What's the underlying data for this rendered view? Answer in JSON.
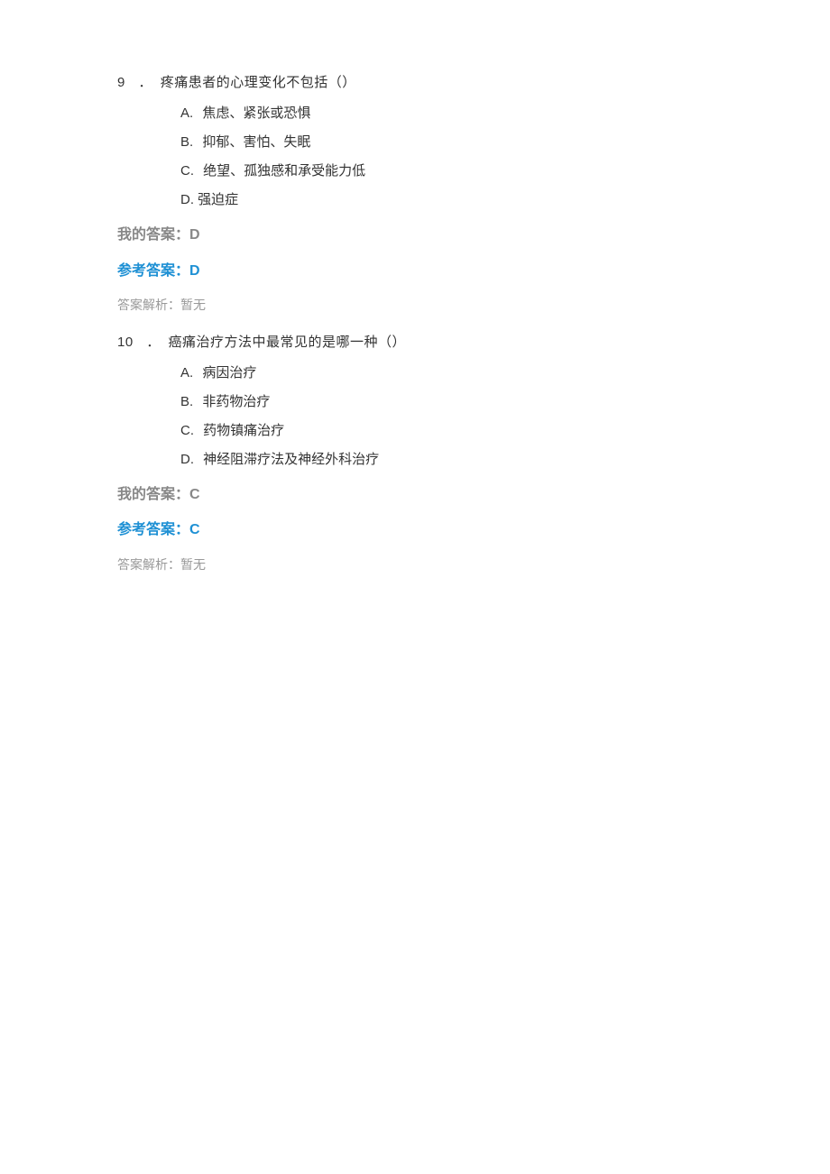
{
  "questions": [
    {
      "number": "9",
      "dot": "．",
      "stem": "疼痛患者的心理变化不包括（）",
      "options": [
        {
          "letter": "A.",
          "text": "焦虑、紧张或恐惧",
          "tight": false
        },
        {
          "letter": "B.",
          "text": "抑郁、害怕、失眠",
          "tight": false
        },
        {
          "letter": "C.",
          "text": "绝望、孤独感和承受能力低",
          "tight": false
        },
        {
          "letter": "D.",
          "text": "强迫症",
          "tight": true
        }
      ],
      "myAnswerLabel": "我的答案：",
      "myAnswerValue": "D",
      "refAnswerLabel": "参考答案：",
      "refAnswerValue": "D",
      "analysisLabel": "答案解析：",
      "analysisText": "暂无"
    },
    {
      "number": "10",
      "dot": "．",
      "stem": "癌痛治疗方法中最常见的是哪一种（）",
      "options": [
        {
          "letter": "A.",
          "text": "病因治疗",
          "tight": false
        },
        {
          "letter": "B.",
          "text": "非药物治疗",
          "tight": false
        },
        {
          "letter": "C.",
          "text": "药物镇痛治疗",
          "tight": false
        },
        {
          "letter": "D.",
          "text": "神经阻滞疗法及神经外科治疗",
          "tight": false
        }
      ],
      "myAnswerLabel": "我的答案：",
      "myAnswerValue": "C",
      "refAnswerLabel": "参考答案：",
      "refAnswerValue": "C",
      "analysisLabel": "答案解析：",
      "analysisText": "暂无"
    }
  ]
}
